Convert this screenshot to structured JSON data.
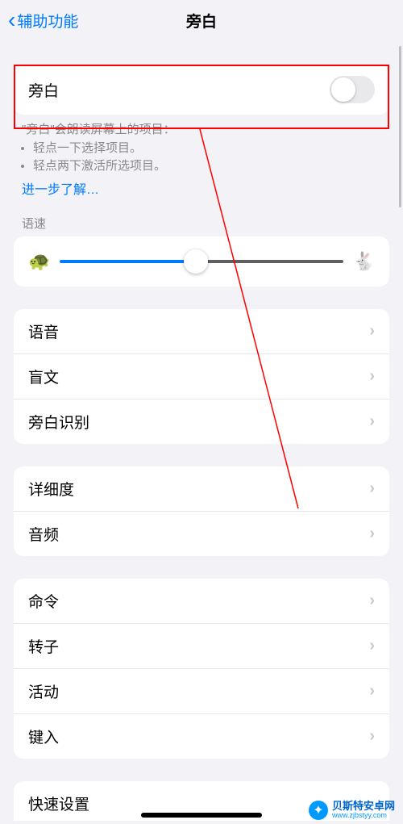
{
  "header": {
    "back": "辅助功能",
    "title": "旁白"
  },
  "toggle": {
    "label": "旁白",
    "on": false
  },
  "description": {
    "main": "\"旁白\"会朗读屏幕上的项目：",
    "bullets": [
      "轻点一下选择项目。",
      "轻点两下激活所选项目。"
    ],
    "learn_more": "进一步了解…"
  },
  "slider": {
    "label": "语速",
    "value_percent": 48
  },
  "group1": [
    "语音",
    "盲文",
    "旁白识别"
  ],
  "group2": [
    "详细度",
    "音频"
  ],
  "group3": [
    "命令",
    "转子",
    "活动",
    "键入"
  ],
  "partial_last": "快速设置",
  "watermark": {
    "cn": "贝斯特安卓网",
    "en": "www.zjbstyy.com"
  }
}
